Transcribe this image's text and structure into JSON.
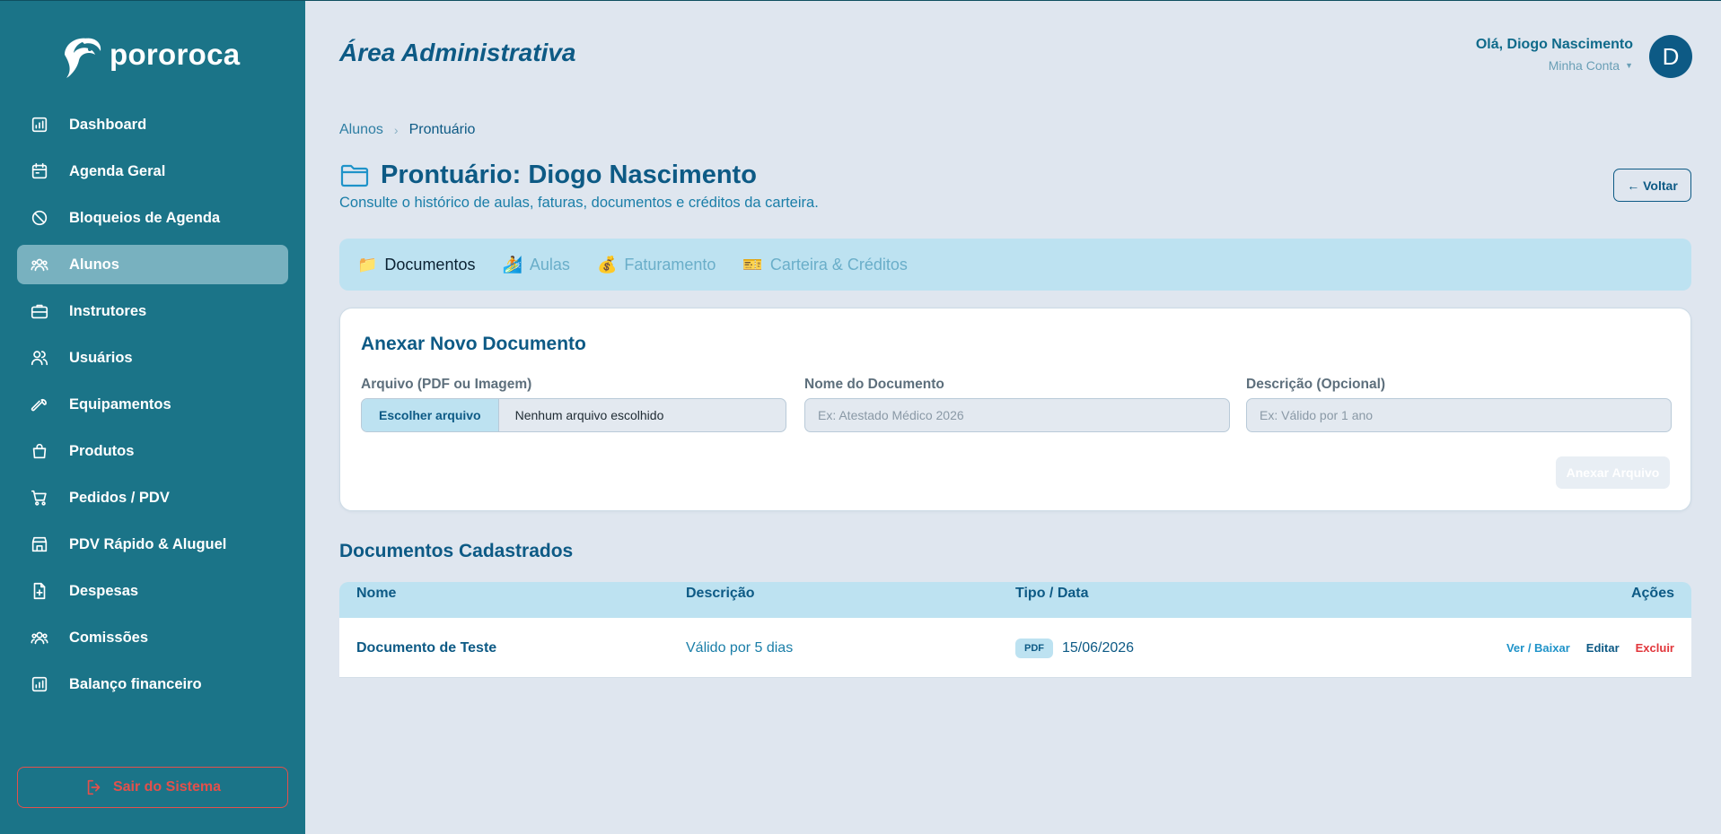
{
  "brand": {
    "name": "pororoca"
  },
  "sidebar": {
    "items": [
      {
        "label": "Dashboard",
        "icon": "chart-icon",
        "active": false
      },
      {
        "label": "Agenda Geral",
        "icon": "calendar-icon",
        "active": false
      },
      {
        "label": "Bloqueios de Agenda",
        "icon": "block-icon",
        "active": false
      },
      {
        "label": "Alunos",
        "icon": "users-icon",
        "active": true
      },
      {
        "label": "Instrutores",
        "icon": "briefcase-icon",
        "active": false
      },
      {
        "label": "Usuários",
        "icon": "user-group-icon",
        "active": false
      },
      {
        "label": "Equipamentos",
        "icon": "wrench-icon",
        "active": false
      },
      {
        "label": "Produtos",
        "icon": "bag-icon",
        "active": false
      },
      {
        "label": "Pedidos / PDV",
        "icon": "cart-icon",
        "active": false
      },
      {
        "label": "PDV Rápido & Aluguel",
        "icon": "store-icon",
        "active": false
      },
      {
        "label": "Despesas",
        "icon": "file-plus-icon",
        "active": false
      },
      {
        "label": "Comissões",
        "icon": "users-icon",
        "active": false
      },
      {
        "label": "Balanço financeiro",
        "icon": "chart-icon",
        "active": false
      }
    ],
    "logout_label": "Sair do Sistema"
  },
  "header": {
    "title": "Área Administrativa",
    "greeting": "Olá, Diogo Nascimento",
    "account_label": "Minha Conta",
    "avatar_letter": "D"
  },
  "breadcrumb": {
    "parent": "Alunos",
    "current": "Prontuário"
  },
  "record": {
    "title": "Prontuário: Diogo Nascimento",
    "subtitle": "Consulte o histórico de aulas, faturas, documentos e créditos da carteira.",
    "back_label": "← Voltar"
  },
  "tabs": [
    {
      "icon": "📁",
      "label": "Documentos",
      "active": true
    },
    {
      "icon": "🏄",
      "label": "Aulas",
      "active": false
    },
    {
      "icon": "💰",
      "label": "Faturamento",
      "active": false
    },
    {
      "icon": "🎫",
      "label": "Carteira & Créditos",
      "active": false
    }
  ],
  "upload_form": {
    "title": "Anexar Novo Documento",
    "file_label": "Arquivo (PDF ou Imagem)",
    "file_button": "Escolher arquivo",
    "file_status": "Nenhum arquivo escolhido",
    "name_label": "Nome do Documento",
    "name_placeholder": "Ex: Atestado Médico 2026",
    "name_value": "",
    "desc_label": "Descrição (Opcional)",
    "desc_placeholder": "Ex: Válido por 1 ano",
    "desc_value": "",
    "submit_label": "Anexar Arquivo"
  },
  "documents": {
    "title": "Documentos Cadastrados",
    "columns": [
      "Nome",
      "Descrição",
      "Tipo / Data",
      "Ações"
    ],
    "rows": [
      {
        "name": "Documento de Teste",
        "description": "Válido por 5 dias",
        "type": "PDF",
        "date": "15/06/2026",
        "actions": {
          "view": "Ver / Baixar",
          "edit": "Editar",
          "delete": "Excluir"
        }
      }
    ]
  },
  "colors": {
    "sidebar": "#1b7488",
    "primary": "#0d5a85",
    "accent": "#1f93c9",
    "danger": "#e2363b",
    "tab_bg": "#bde2f1"
  }
}
